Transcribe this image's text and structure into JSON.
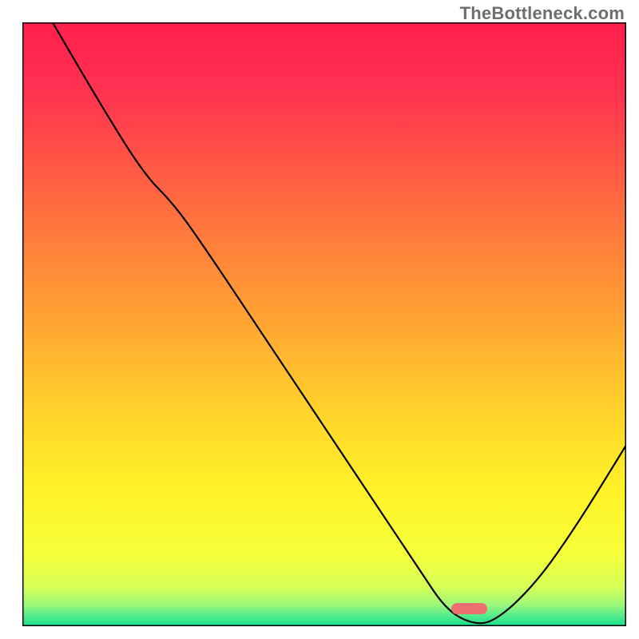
{
  "watermark": "TheBottleneck.com",
  "gradient_stops": [
    {
      "offset": 0.0,
      "color": "#ff1f4e"
    },
    {
      "offset": 0.12,
      "color": "#ff3450"
    },
    {
      "offset": 0.3,
      "color": "#ff6b3f"
    },
    {
      "offset": 0.48,
      "color": "#ffa033"
    },
    {
      "offset": 0.64,
      "color": "#ffd22b"
    },
    {
      "offset": 0.78,
      "color": "#fff328"
    },
    {
      "offset": 0.88,
      "color": "#f6ff3a"
    },
    {
      "offset": 0.935,
      "color": "#d6ff58"
    },
    {
      "offset": 0.965,
      "color": "#9cf87a"
    },
    {
      "offset": 0.985,
      "color": "#4be98f"
    },
    {
      "offset": 1.0,
      "color": "#16df8a"
    }
  ],
  "chart_data": {
    "type": "line",
    "title": "",
    "xlabel": "",
    "ylabel": "",
    "xlim": [
      0,
      100
    ],
    "ylim": [
      0,
      100
    ],
    "legend": false,
    "grid": false,
    "series": [
      {
        "name": "curve",
        "x": [
          5,
          12,
          20,
          25,
          30,
          40,
          50,
          60,
          66,
          70,
          74,
          78,
          85,
          92,
          100
        ],
        "y": [
          100,
          88,
          75,
          70,
          63,
          48,
          33,
          18,
          9,
          3,
          0.5,
          0.5,
          7,
          17,
          30
        ]
      }
    ],
    "marker": {
      "x_center": 74,
      "width_pct": 6,
      "color": "#ed6f72"
    }
  },
  "border_color": "#010101"
}
